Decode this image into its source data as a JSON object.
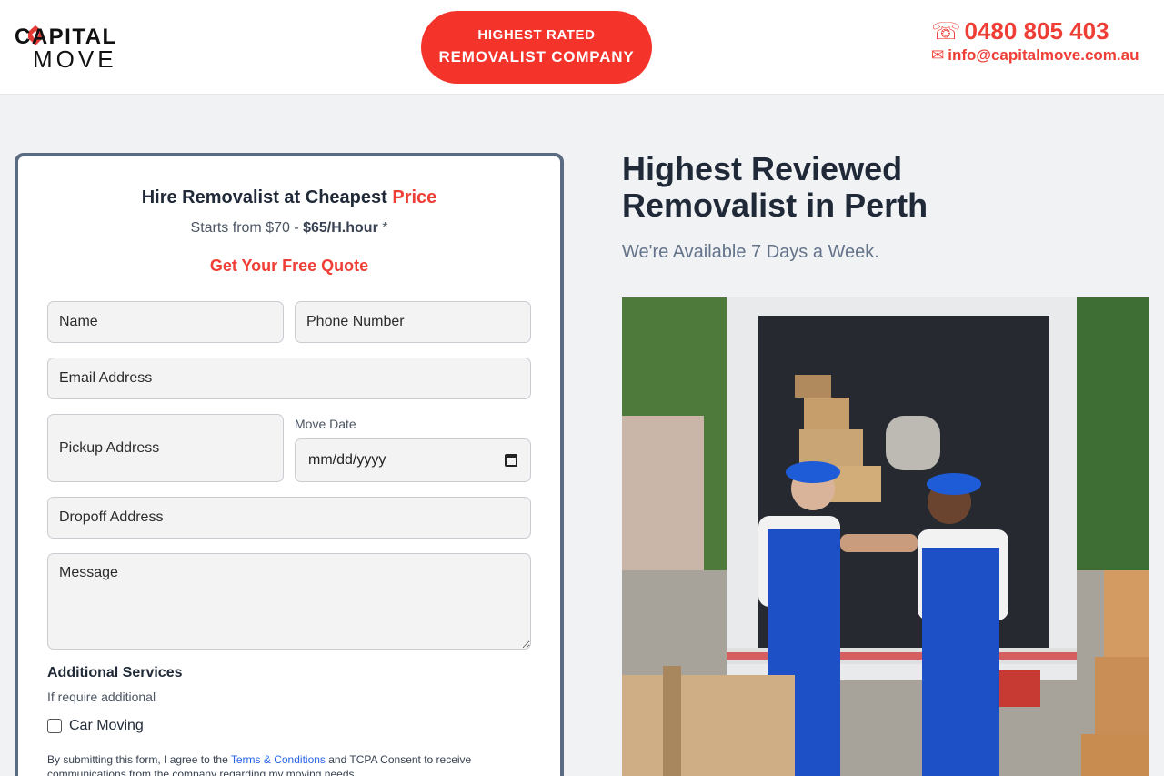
{
  "header": {
    "logo": {
      "line1": "CAPITAL",
      "line2": "MOVE"
    },
    "badge": {
      "line1": "HIGHEST RATED",
      "line2": "REMOVALIST COMPANY"
    },
    "contact": {
      "phone": "0480 805 403",
      "email": "info@capitalmove.com.au",
      "phone_icon": "phone-icon",
      "email_icon": "mail-icon"
    }
  },
  "form": {
    "title_main": "Hire Removalist at Cheapest ",
    "title_accent": "Price",
    "subtitle_prefix": "Starts from $70 - ",
    "subtitle_bold": "$65/H.hour",
    "subtitle_suffix": " *",
    "cta": "Get Your Free Quote",
    "name_placeholder": "Name",
    "phone_placeholder": "Phone Number",
    "email_placeholder": "Email Address",
    "pickup_placeholder": "Pickup Address",
    "move_date_label": "Move Date",
    "move_date_value": "mm/dd/yyyy",
    "dropoff_placeholder": "Dropoff Address",
    "message_placeholder": "Message",
    "additional_title": "Additional Services",
    "additional_sub": "If require additional",
    "car_moving_label": "Car Moving",
    "consent_prefix": "By submitting this form, I agree to the ",
    "consent_link": "Terms & Conditions",
    "consent_suffix": " and TCPA Consent to receive communications from the company regarding my moving needs."
  },
  "hero": {
    "title_line1": "Highest Reviewed",
    "title_line2": "Removalist in Perth",
    "subtitle": "We're Available 7 Days a Week."
  },
  "colors": {
    "accent": "#ef3e36",
    "badge": "#f4332b",
    "card_border": "#5b6b82",
    "link": "#2563eb"
  }
}
